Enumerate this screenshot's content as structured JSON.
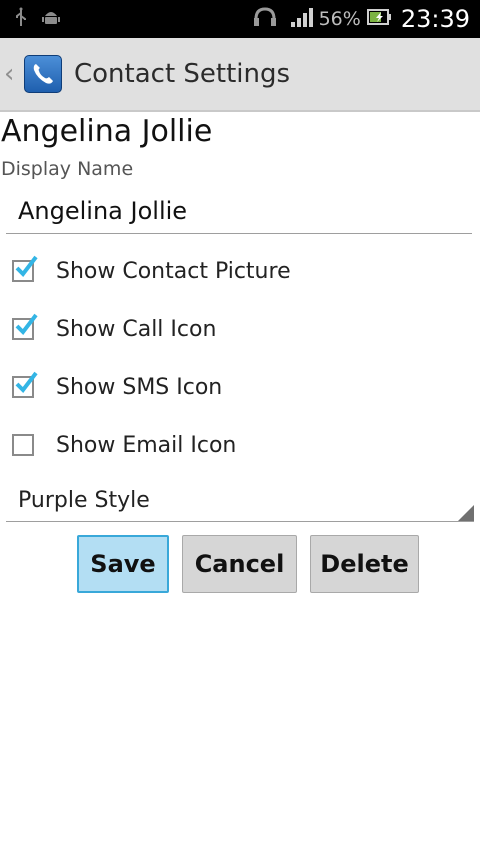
{
  "status_bar": {
    "battery_percent": "56%",
    "time": "23:39"
  },
  "action_bar": {
    "title": "Contact Settings"
  },
  "contact": {
    "name_heading": "Angelina Jollie",
    "display_name_label": "Display Name",
    "display_name_value": "Angelina Jollie"
  },
  "options": [
    {
      "label": "Show Contact Picture",
      "checked": true
    },
    {
      "label": "Show Call Icon",
      "checked": true
    },
    {
      "label": "Show SMS Icon",
      "checked": true
    },
    {
      "label": "Show Email Icon",
      "checked": false
    }
  ],
  "style_spinner": {
    "selected": "Purple Style"
  },
  "buttons": {
    "save": "Save",
    "cancel": "Cancel",
    "delete": "Delete"
  },
  "colors": {
    "checkmark": "#33b5e5",
    "save_highlight": "#b3def3",
    "action_bar_bg": "#e0e0e0"
  },
  "icons": {
    "status_left": [
      "usb-icon",
      "android-debug-icon"
    ],
    "status_right": [
      "headset-icon",
      "signal-icon",
      "battery-charging-icon"
    ],
    "app": "phone-handset-icon"
  }
}
